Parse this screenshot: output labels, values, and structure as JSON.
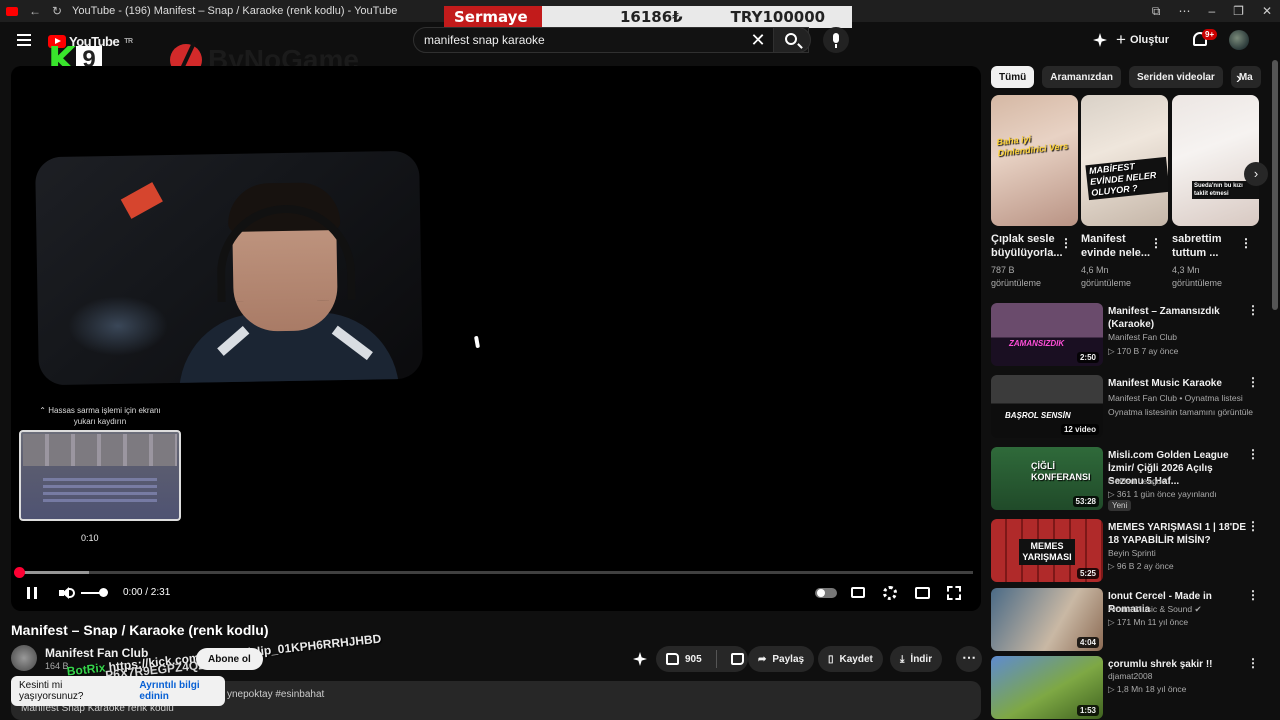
{
  "titlebar": {
    "title": "YouTube - (196) Manifest – Snap / Karaoke (renk kodlu) - YouTube"
  },
  "overlay": {
    "label": "Sermaye",
    "value1": "16186₺",
    "value2": "TRY100000"
  },
  "header": {
    "logo_text": "YouTube",
    "logo_region": "TR",
    "search_value": "manifest snap karaoke",
    "create_label": "Oluştur",
    "notif_count": "9+"
  },
  "stream_logos": {
    "k": "K",
    "nine": "9",
    "brand": "ByNoGame"
  },
  "player": {
    "scrub_tip": "⌃ Hassas sarma işlemi için ekranı yukarı kaydırın",
    "preview_time": "0:10",
    "time_display": "0:00 / 2:31",
    "progress_fraction": 0.0
  },
  "video": {
    "title": "Manifest – Snap / Karaoke (renk kodlu)",
    "channel": "Manifest Fan Club",
    "subs": "164 B",
    "subscribe_label": "Abone ol",
    "likes": "905",
    "share_label": "Paylaş",
    "save_label": "Kaydet",
    "download_label": "İndir",
    "overlay_bot": "BotRix",
    "overlay_url": "https://kick.com/u...clips/clip_01KPH6RRHJHBD",
    "overlay_code": "P6X7R9EGPZ4Q2",
    "desc_tags": "ynepoktay #esinbahat",
    "desc_line2": "Manifest Snap Karaoke renk kodlu"
  },
  "toast": {
    "text": "Kesinti mi yaşıyorsunuz?",
    "link": "Ayrıntılı bilgi edinin"
  },
  "chips": [
    "Tümü",
    "Aramanızdan",
    "Seriden videolar",
    "Ma"
  ],
  "shorts": [
    {
      "caption": "Baha iyi Dinlendirici Vers",
      "title": "Çıplak sesle büyülüyorla...",
      "views": "787 B",
      "views_label": "görüntüleme"
    },
    {
      "caption": "MABİFEST EVİNDE NELER OLUYOR ?",
      "title": "Manifest evinde nele...",
      "views": "4,6 Mn",
      "views_label": "görüntüleme"
    },
    {
      "caption": "Sueda'nın bu kızı taklit etmesi",
      "title": "sabrettim tuttum ...",
      "views": "4,3 Mn",
      "views_label": "görüntüleme"
    }
  ],
  "recommendations": [
    {
      "title": "Manifest – Zamansızdık (Karaoke)",
      "channel": "Manifest Fan Club",
      "meta": "▷ 170 B   7 ay önce",
      "duration": "2:50",
      "thumb_text": "ZAMANSIZDIK"
    },
    {
      "title": "Manifest Music Karaoke",
      "channel": "Manifest Fan Club • Oynatma listesi",
      "meta": "Oynatma listesinin tamamını görüntüle",
      "duration": "12 video",
      "thumb_text": "BAŞROL SENSİN"
    },
    {
      "title": "Misli.com Golden League İzmir/ Çiğli 2026 Açılış Sezonu 5.Haf...",
      "channel": "Golden League",
      "meta": "▷ 361   1 gün önce yayınlandı",
      "duration": "53:28",
      "badge": "Yeni",
      "thumb_text": "ÇİĞLİ KONFERANSI"
    },
    {
      "title": "MEMES YARIŞMASI 1 | 18'DE 18 YAPABİLİR MİSİN?",
      "channel": "Beyin Sprinti",
      "meta": "▷ 96 B   2 ay önce",
      "duration": "5:25",
      "thumb_text": "MEMES YARIŞMASI"
    },
    {
      "title": "Ionut Cercel - Made in Romania",
      "channel": "Amma Music & Sound ✔",
      "meta": "▷ 171 Mn   11 yıl önce",
      "duration": "4:04"
    },
    {
      "title": "çorumlu shrek şakir !!",
      "channel": "djamat2008",
      "meta": "▷ 1,8 Mn   18 yıl önce",
      "duration": "1:53"
    }
  ]
}
